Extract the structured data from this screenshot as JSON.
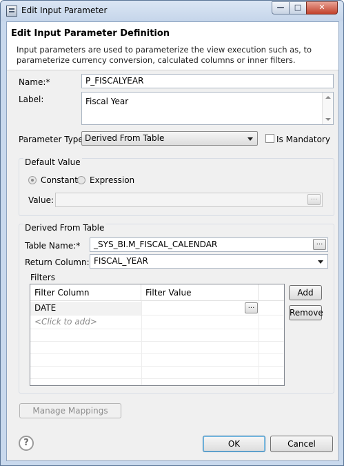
{
  "window": {
    "title": "Edit Input Parameter",
    "min_symbol": "—",
    "max_symbol": "□",
    "close_symbol": "✕"
  },
  "header": {
    "title": "Edit Input Parameter Definition",
    "description": "Input parameters are used to parameterize the view execution such as, to parameterize currency conversion, calculated columns or inner filters."
  },
  "form": {
    "name_label": "Name:*",
    "name_value": "P_FISCALYEAR",
    "label_label": "Label:",
    "label_value": "Fiscal Year",
    "parameter_type_label": "Parameter Type:",
    "parameter_type_value": "Derived From Table",
    "is_mandatory_label": "Is Mandatory",
    "is_mandatory_checked": false
  },
  "default_value": {
    "group_title": "Default Value",
    "constant_label": "Constant",
    "expression_label": "Expression",
    "selected": "Constant",
    "value_label": "Value:",
    "value": ""
  },
  "derived": {
    "group_title": "Derived From Table",
    "table_name_label": "Table Name:*",
    "table_name_value": "_SYS_BI.M_FISCAL_CALENDAR",
    "return_column_label": "Return Column:*",
    "return_column_value": "FISCAL_YEAR",
    "ellipsis": "..."
  },
  "filters": {
    "group_title": "Filters",
    "columns": [
      "Filter Column",
      "Filter Value"
    ],
    "rows": [
      {
        "filter_column": "DATE",
        "filter_value": ""
      }
    ],
    "add_row_hint": "<Click to add>",
    "add_button": "Add",
    "remove_button": "Remove"
  },
  "footer": {
    "manage_mappings": "Manage Mappings",
    "ok": "OK",
    "cancel": "Cancel",
    "help_symbol": "?"
  }
}
